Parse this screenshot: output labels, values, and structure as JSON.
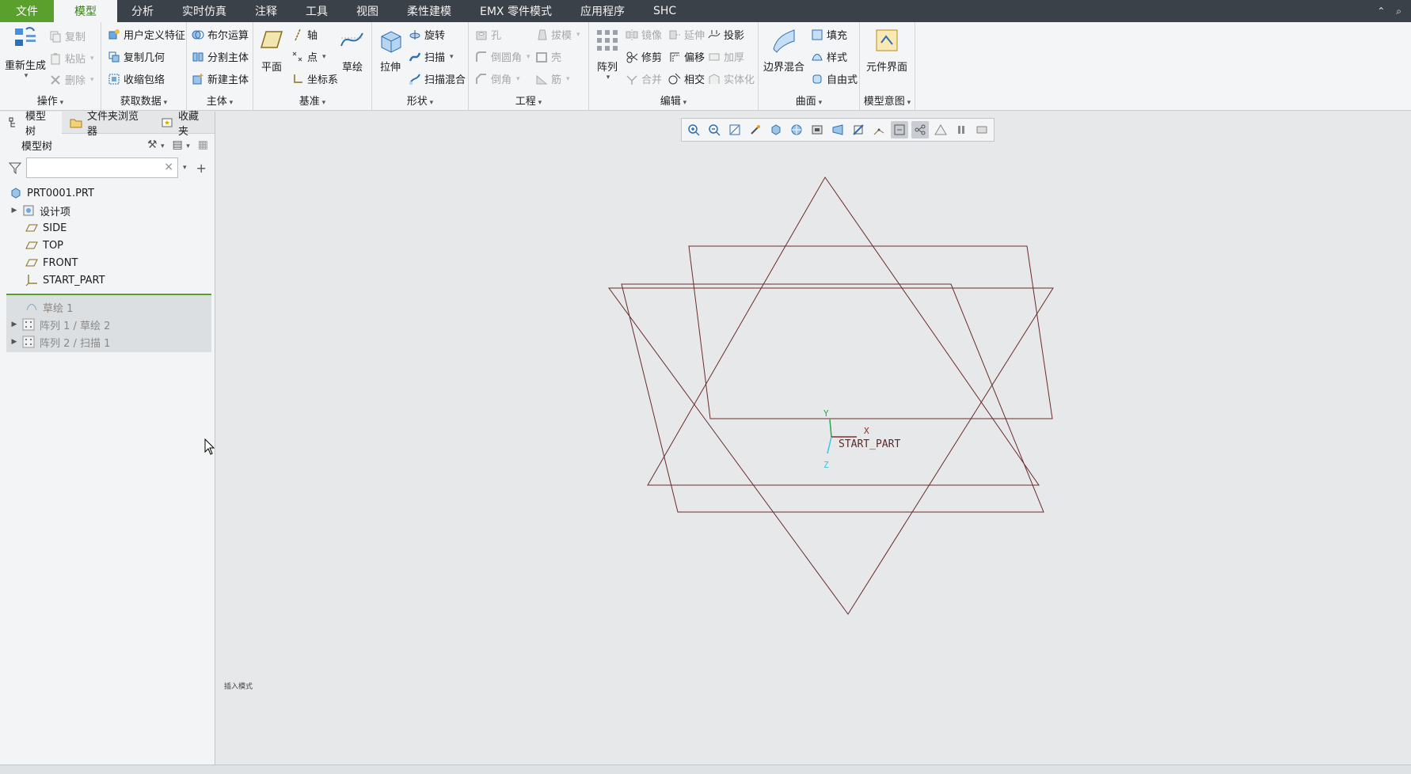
{
  "menu": {
    "tabs": [
      "文件",
      "模型",
      "分析",
      "实时仿真",
      "注释",
      "工具",
      "视图",
      "柔性建模",
      "EMX 零件模式",
      "应用程序",
      "SHC"
    ],
    "active": "模型"
  },
  "ribbon": {
    "operations": {
      "regenerate": "重新生成",
      "copy": "复制",
      "paste": "粘贴",
      "delete": "删除",
      "label": "操作"
    },
    "getdata": {
      "udf": "用户定义特征",
      "copygeom": "复制几何",
      "shrinkwrap": "收缩包络",
      "label": "获取数据"
    },
    "body": {
      "boolean": "布尔运算",
      "split": "分割主体",
      "newbody": "新建主体",
      "label": "主体"
    },
    "datum": {
      "plane": "平面",
      "axis": "轴",
      "point": "点",
      "csys": "坐标系",
      "sketch": "草绘",
      "label": "基准"
    },
    "shapes": {
      "extrude": "拉伸",
      "revolve": "旋转",
      "sweep": "扫描",
      "sweptblend": "扫描混合",
      "label": "形状"
    },
    "engineering": {
      "hole": "孔",
      "round": "倒圆角",
      "chamfer": "倒角",
      "draft": "拔模",
      "shell": "壳",
      "rib": "筋",
      "label": "工程"
    },
    "editing": {
      "pattern": "阵列",
      "mirror": "镜像",
      "extend": "延伸",
      "project": "投影",
      "trim": "修剪",
      "offset": "偏移",
      "thicken": "加厚",
      "merge": "合并",
      "intersect": "相交",
      "solidify": "实体化",
      "label": "编辑"
    },
    "surfaces": {
      "boundary": "边界混合",
      "fill": "填充",
      "style": "样式",
      "freestyle": "自由式",
      "label": "曲面"
    },
    "intent": {
      "component": "元件界面",
      "label": "模型意图"
    }
  },
  "panel": {
    "tabs": [
      "模型树",
      "文件夹浏览器",
      "收藏夹"
    ],
    "tree_title": "模型树",
    "search_placeholder": "",
    "nodes": [
      {
        "label": "PRT0001.PRT",
        "icon": "part-icon"
      },
      {
        "label": "设计项",
        "icon": "design-items-icon"
      },
      {
        "label": "SIDE",
        "icon": "datum-plane-icon"
      },
      {
        "label": "TOP",
        "icon": "datum-plane-icon"
      },
      {
        "label": "FRONT",
        "icon": "datum-plane-icon"
      },
      {
        "label": "START_PART",
        "icon": "csys-icon"
      }
    ],
    "features": [
      {
        "label": "草绘 1",
        "icon": "sketch-icon"
      },
      {
        "label": "阵列 1 / 草绘 2",
        "icon": "pattern-icon"
      },
      {
        "label": "阵列 2 / 扫描 1",
        "icon": "pattern-icon"
      }
    ]
  },
  "graphics": {
    "csys_label": "START_PART",
    "axes": {
      "x": "X",
      "y": "Y",
      "z": "Z"
    },
    "mode_text": "插入模式",
    "line_color": "#6b2b2b"
  },
  "colors": {
    "accent": "#5aa02c",
    "menubar": "#3a4148"
  }
}
